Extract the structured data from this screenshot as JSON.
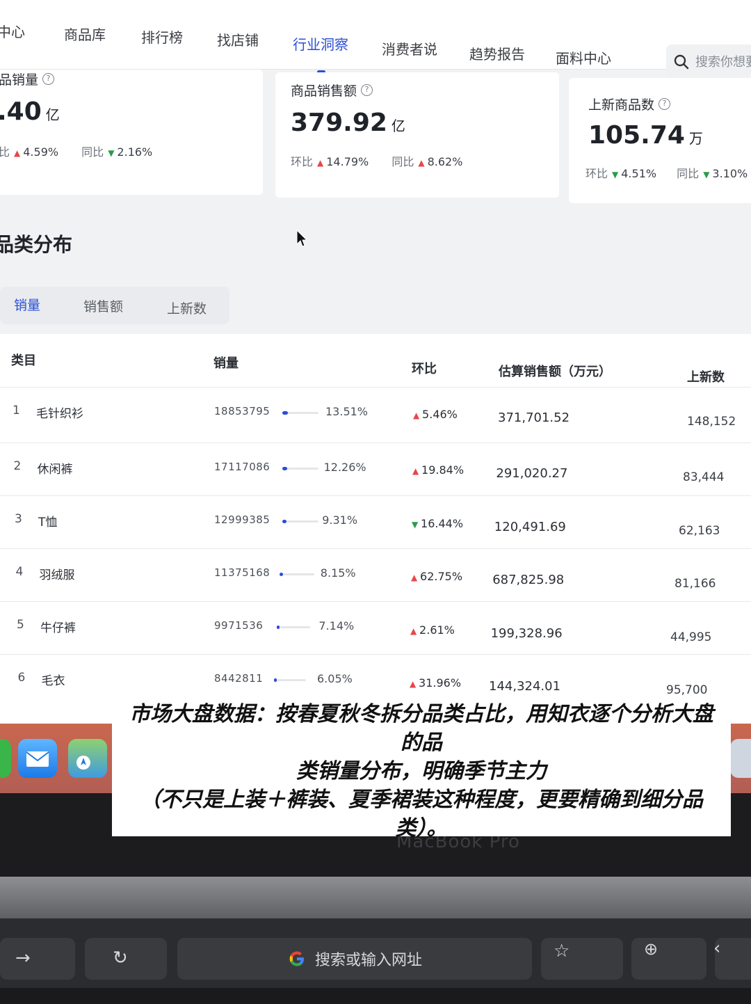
{
  "nav": {
    "items": [
      "中心",
      "商品库",
      "排行榜",
      "找店铺",
      "行业洞察",
      "消费者说",
      "趋势报告",
      "面料中心"
    ],
    "active_index": 4,
    "search_placeholder": "搜索你想要"
  },
  "metrics": [
    {
      "title": "品销量",
      "value": ".40",
      "unit": "亿",
      "mom_label": "比",
      "mom_dir": "up",
      "mom": "4.59%",
      "yoy_label": "同比",
      "yoy_dir": "down",
      "yoy": "2.16%"
    },
    {
      "title": "商品销售额",
      "value": "379.92",
      "unit": "亿",
      "mom_label": "环比",
      "mom_dir": "up",
      "mom": "14.79%",
      "yoy_label": "同比",
      "yoy_dir": "up",
      "yoy": "8.62%"
    },
    {
      "title": "上新商品数",
      "value": "105.74",
      "unit": "万",
      "mom_label": "环比",
      "mom_dir": "down",
      "mom": "4.51%",
      "yoy_label": "同比",
      "yoy_dir": "down",
      "yoy": "3.10%"
    }
  ],
  "section_title": "品类分布",
  "tabs": [
    "销量",
    "销售额",
    "上新数"
  ],
  "active_tab": 0,
  "table": {
    "headers": [
      "类目",
      "销量",
      "环比",
      "估算销售额（万元）",
      "上新数"
    ],
    "rows": [
      {
        "rank": "1",
        "name": "毛针织衫",
        "sales": "18853795",
        "share": "13.51%",
        "share_value": 0.1351,
        "mom_dir": "up",
        "mom": "5.46%",
        "amount": "371,701.52",
        "new": "148,152"
      },
      {
        "rank": "2",
        "name": "休闲裤",
        "sales": "17117086",
        "share": "12.26%",
        "share_value": 0.1226,
        "mom_dir": "up",
        "mom": "19.84%",
        "amount": "291,020.27",
        "new": "83,444"
      },
      {
        "rank": "3",
        "name": "T恤",
        "sales": "12999385",
        "share": "9.31%",
        "share_value": 0.0931,
        "mom_dir": "down",
        "mom": "16.44%",
        "amount": "120,491.69",
        "new": "62,163"
      },
      {
        "rank": "4",
        "name": "羽绒服",
        "sales": "11375168",
        "share": "8.15%",
        "share_value": 0.0815,
        "mom_dir": "up",
        "mom": "62.75%",
        "amount": "687,825.98",
        "new": "81,166"
      },
      {
        "rank": "5",
        "name": "牛仔裤",
        "sales": "9971536",
        "share": "7.14%",
        "share_value": 0.0714,
        "mom_dir": "up",
        "mom": "2.61%",
        "amount": "199,328.96",
        "new": "44,995"
      },
      {
        "rank": "6",
        "name": "毛衣",
        "sales": "8442811",
        "share": "6.05%",
        "share_value": 0.0605,
        "mom_dir": "up",
        "mom": "31.96%",
        "amount": "144,324.01",
        "new": "95,700"
      }
    ]
  },
  "laptop_label": "MacBook Pro",
  "touchbar": {
    "url_placeholder": "搜索或输入网址"
  },
  "caption": {
    "line1": "市场大盘数据：按春夏秋冬拆分品类占比，用知衣逐个分析大盘的品",
    "line2": "类销量分布，明确季节主力",
    "line3": "（不只是上装＋裤装、夏季裙装这种程度，更要精确到细分品类）。"
  },
  "colors": {
    "accent": "#2a4fd6",
    "up": "#e8464a",
    "down": "#2a9c4a"
  }
}
